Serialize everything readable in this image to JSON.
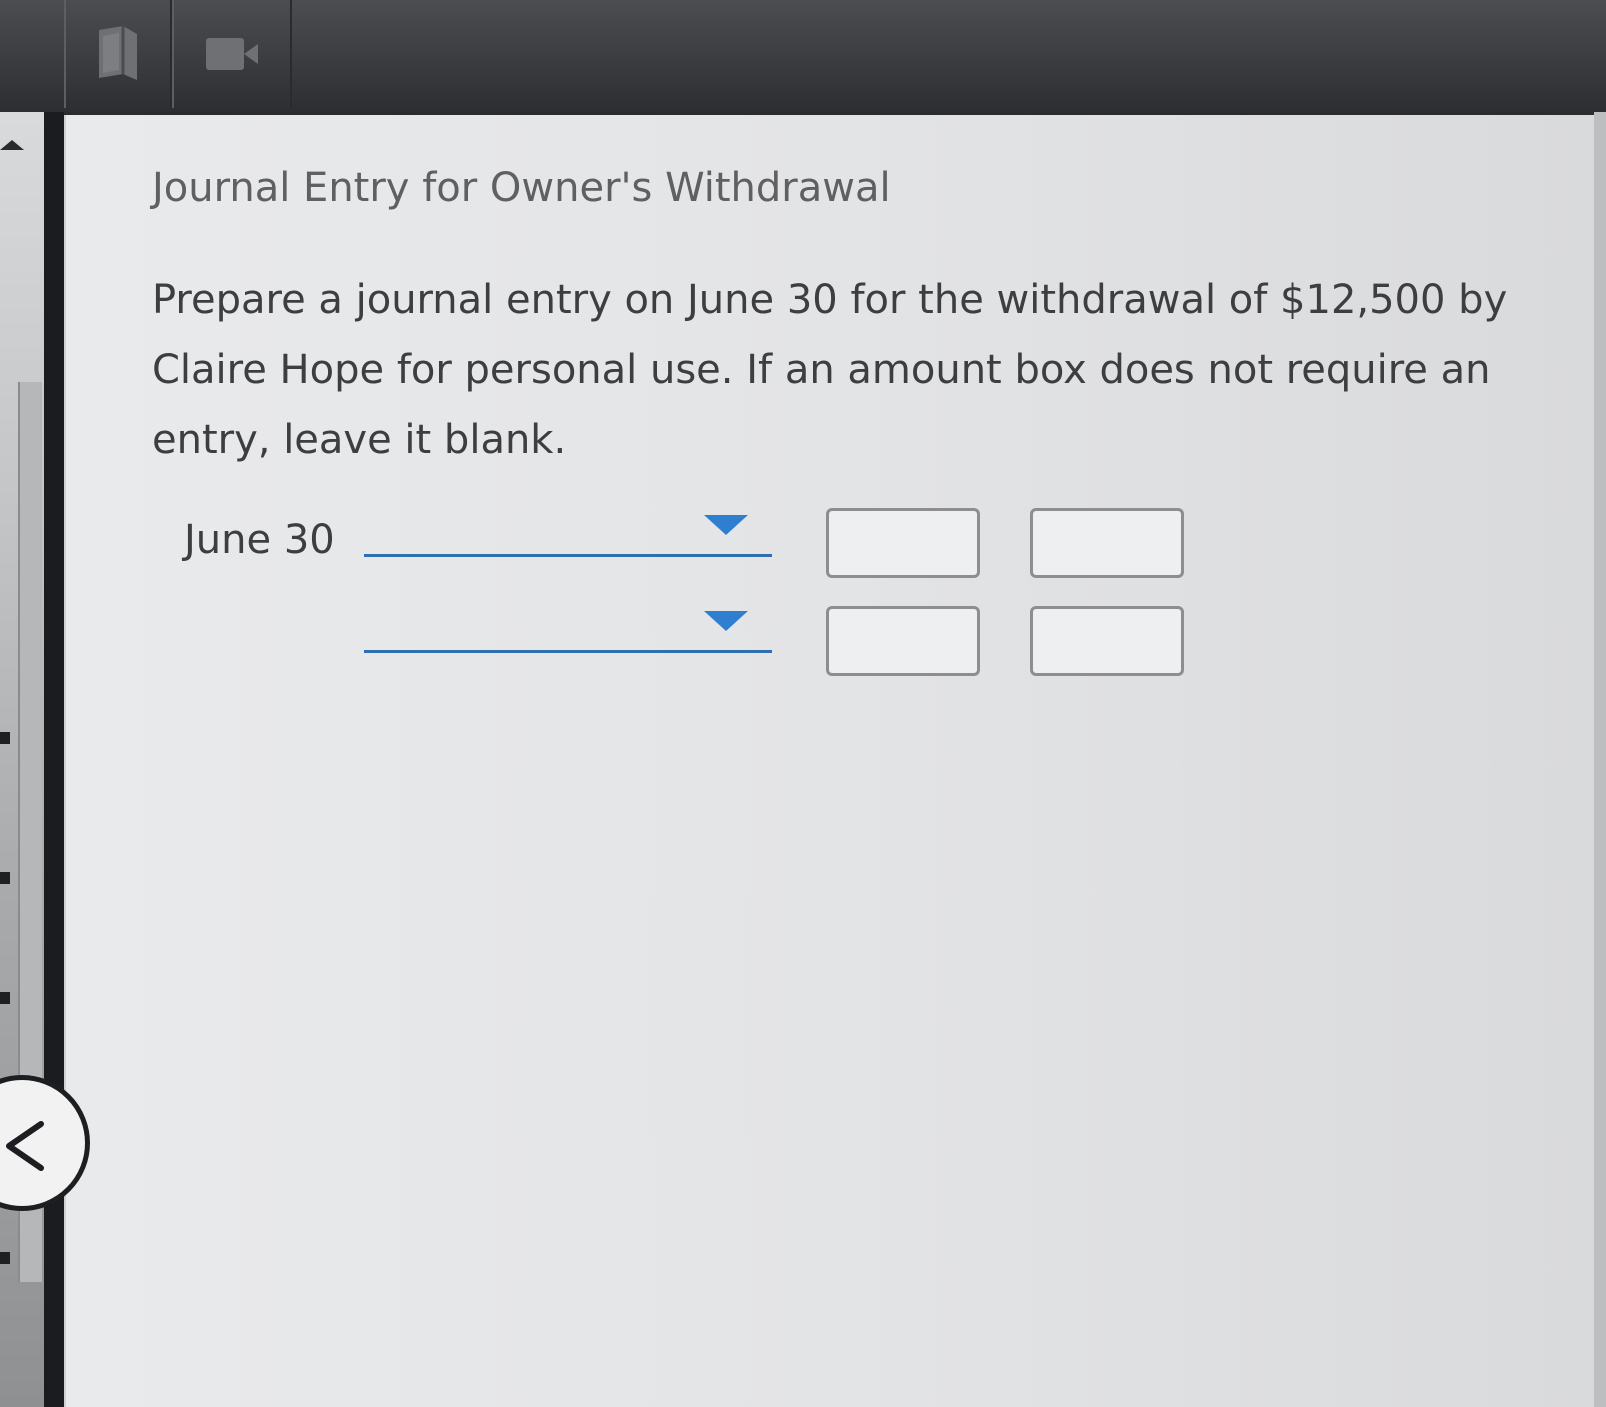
{
  "toolbar": {
    "buttons": [
      {
        "icon": "ebook-icon"
      },
      {
        "icon": "video-icon"
      }
    ]
  },
  "navigation": {
    "back_icon": "chevron-left-icon",
    "scroll_up_icon": "arrow-up-icon"
  },
  "question": {
    "title": "Journal Entry for Owner's Withdrawal",
    "instructions": "Prepare a journal entry on June 30 for the withdrawal of $12,500 by Claire Hope for personal use. If an amount box does not require an entry, leave it blank."
  },
  "journal": {
    "rows": [
      {
        "date": "June 30",
        "account": "",
        "debit": "",
        "credit": ""
      },
      {
        "date": "",
        "account": "",
        "debit": "",
        "credit": ""
      }
    ]
  },
  "colors": {
    "accent": "#2f7fd0",
    "panel": "#e6e7e9",
    "toolbar": "#3a3c40"
  }
}
